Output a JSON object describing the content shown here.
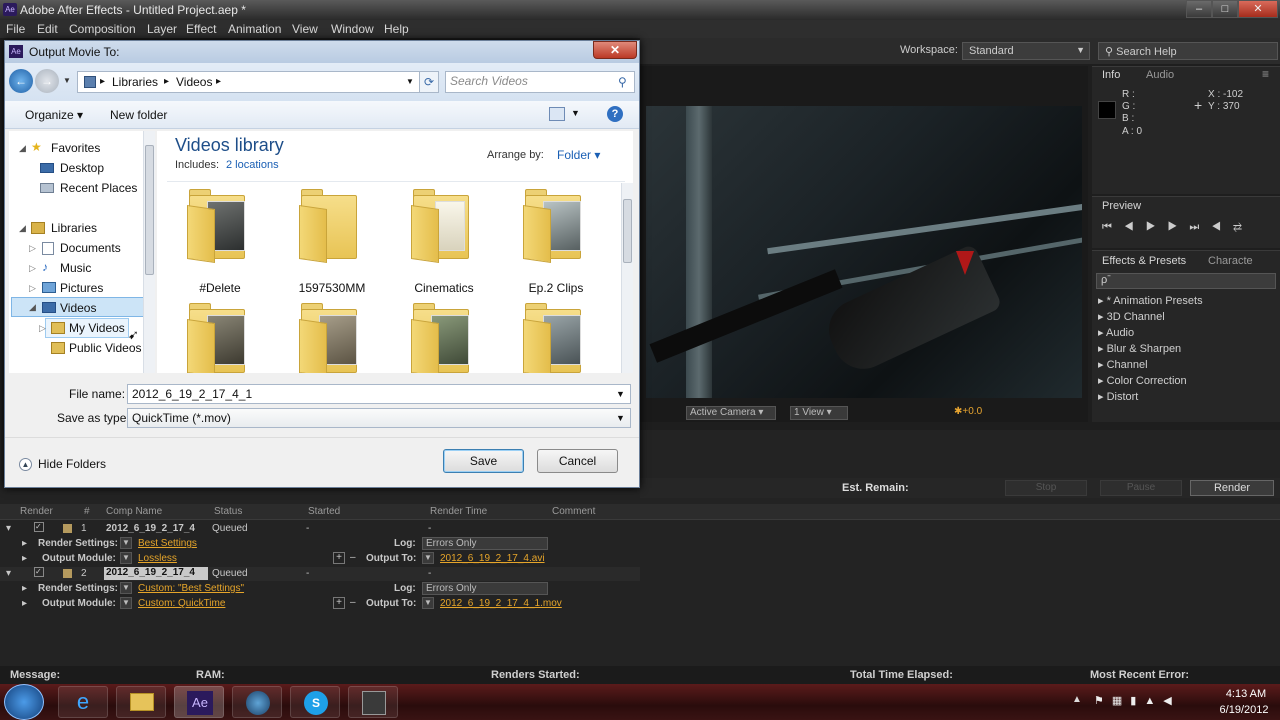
{
  "window": {
    "title": "Adobe After Effects - Untitled Project.aep *"
  },
  "menu": [
    "File",
    "Edit",
    "Composition",
    "Layer",
    "Effect",
    "Animation",
    "View",
    "Window",
    "Help"
  ],
  "workspace": {
    "label": "Workspace:",
    "value": "Standard"
  },
  "search_help": "Search Help",
  "info_panel": {
    "tabs": [
      "Info",
      "Audio"
    ],
    "r": "R :",
    "g": "G :",
    "b": "B :",
    "a": "A : 0",
    "x": "X : -102",
    "y": "Y : 370"
  },
  "preview_panel": {
    "tab": "Preview"
  },
  "effects_panel": {
    "tabs": [
      "Effects & Presets",
      "Characte"
    ],
    "search_placeholder": "ρˉ",
    "items": [
      "* Animation Presets",
      "3D Channel",
      "Audio",
      "Blur & Sharpen",
      "Channel",
      "Color Correction",
      "Distort"
    ]
  },
  "viewer": {
    "camera": "Active Camera",
    "view": "1 View",
    "exposure": "+0.0"
  },
  "dialog": {
    "title": "Output Movie To:",
    "breadcrumb": [
      "Libraries",
      "Videos"
    ],
    "search_placeholder": "Search Videos",
    "organize": "Organize",
    "new_folder": "New folder",
    "library_title": "Videos library",
    "includes_label": "Includes:",
    "includes_link": "2 locations",
    "arrange_label": "Arrange by:",
    "arrange_value": "Folder",
    "tree": {
      "favorites": "Favorites",
      "desktop": "Desktop",
      "recent": "Recent Places",
      "libraries": "Libraries",
      "documents": "Documents",
      "music": "Music",
      "pictures": "Pictures",
      "videos": "Videos",
      "my_videos": "My Videos",
      "public_videos": "Public Videos"
    },
    "folders": [
      "#Delete",
      "1597530MM",
      "Cinematics",
      "Ep.2 Clips"
    ],
    "file_name_label": "File name:",
    "file_name_value": "2012_6_19_2_17_4_1",
    "save_type_label": "Save as type:",
    "save_type_value": "QuickTime (*.mov)",
    "hide_folders": "Hide Folders",
    "save": "Save",
    "cancel": "Cancel"
  },
  "render_queue": {
    "est_remain": "Est. Remain:",
    "stop": "Stop",
    "pause": "Pause",
    "render": "Render",
    "columns": [
      "Render",
      "#",
      "Comp Name",
      "Status",
      "Started",
      "Render Time",
      "Comment"
    ],
    "items": [
      {
        "num": "1",
        "comp": "2012_6_19_2_17_4",
        "status": "Queued",
        "started": "-",
        "render_time": "-",
        "render_settings": "Best Settings",
        "log": "Errors Only",
        "output_module": "Lossless",
        "output_to": "2012_6_19_2_17_4.avi"
      },
      {
        "num": "2",
        "comp": "2012_6_19_2_17_4",
        "status": "Queued",
        "started": "-",
        "render_time": "-",
        "render_settings": "Custom: \"Best Settings\"",
        "log": "Errors Only",
        "output_module": "Custom: QuickTime",
        "output_to": "2012_6_19_2_17_4_1.mov"
      }
    ],
    "labels": {
      "render_settings": "Render Settings:",
      "output_module": "Output Module:",
      "log": "Log:",
      "output_to": "Output To:"
    }
  },
  "status_bar": {
    "message": "Message:",
    "ram": "RAM:",
    "renders_started": "Renders Started:",
    "total_elapsed": "Total Time Elapsed:",
    "recent_error": "Most Recent Error:"
  },
  "taskbar": {
    "time": "4:13 AM",
    "date": "6/19/2012",
    "apps": [
      "start-button",
      "internet-explorer-icon",
      "file-explorer-icon",
      "after-effects-icon",
      "media-player-icon",
      "skype-icon",
      "game-icon"
    ]
  }
}
